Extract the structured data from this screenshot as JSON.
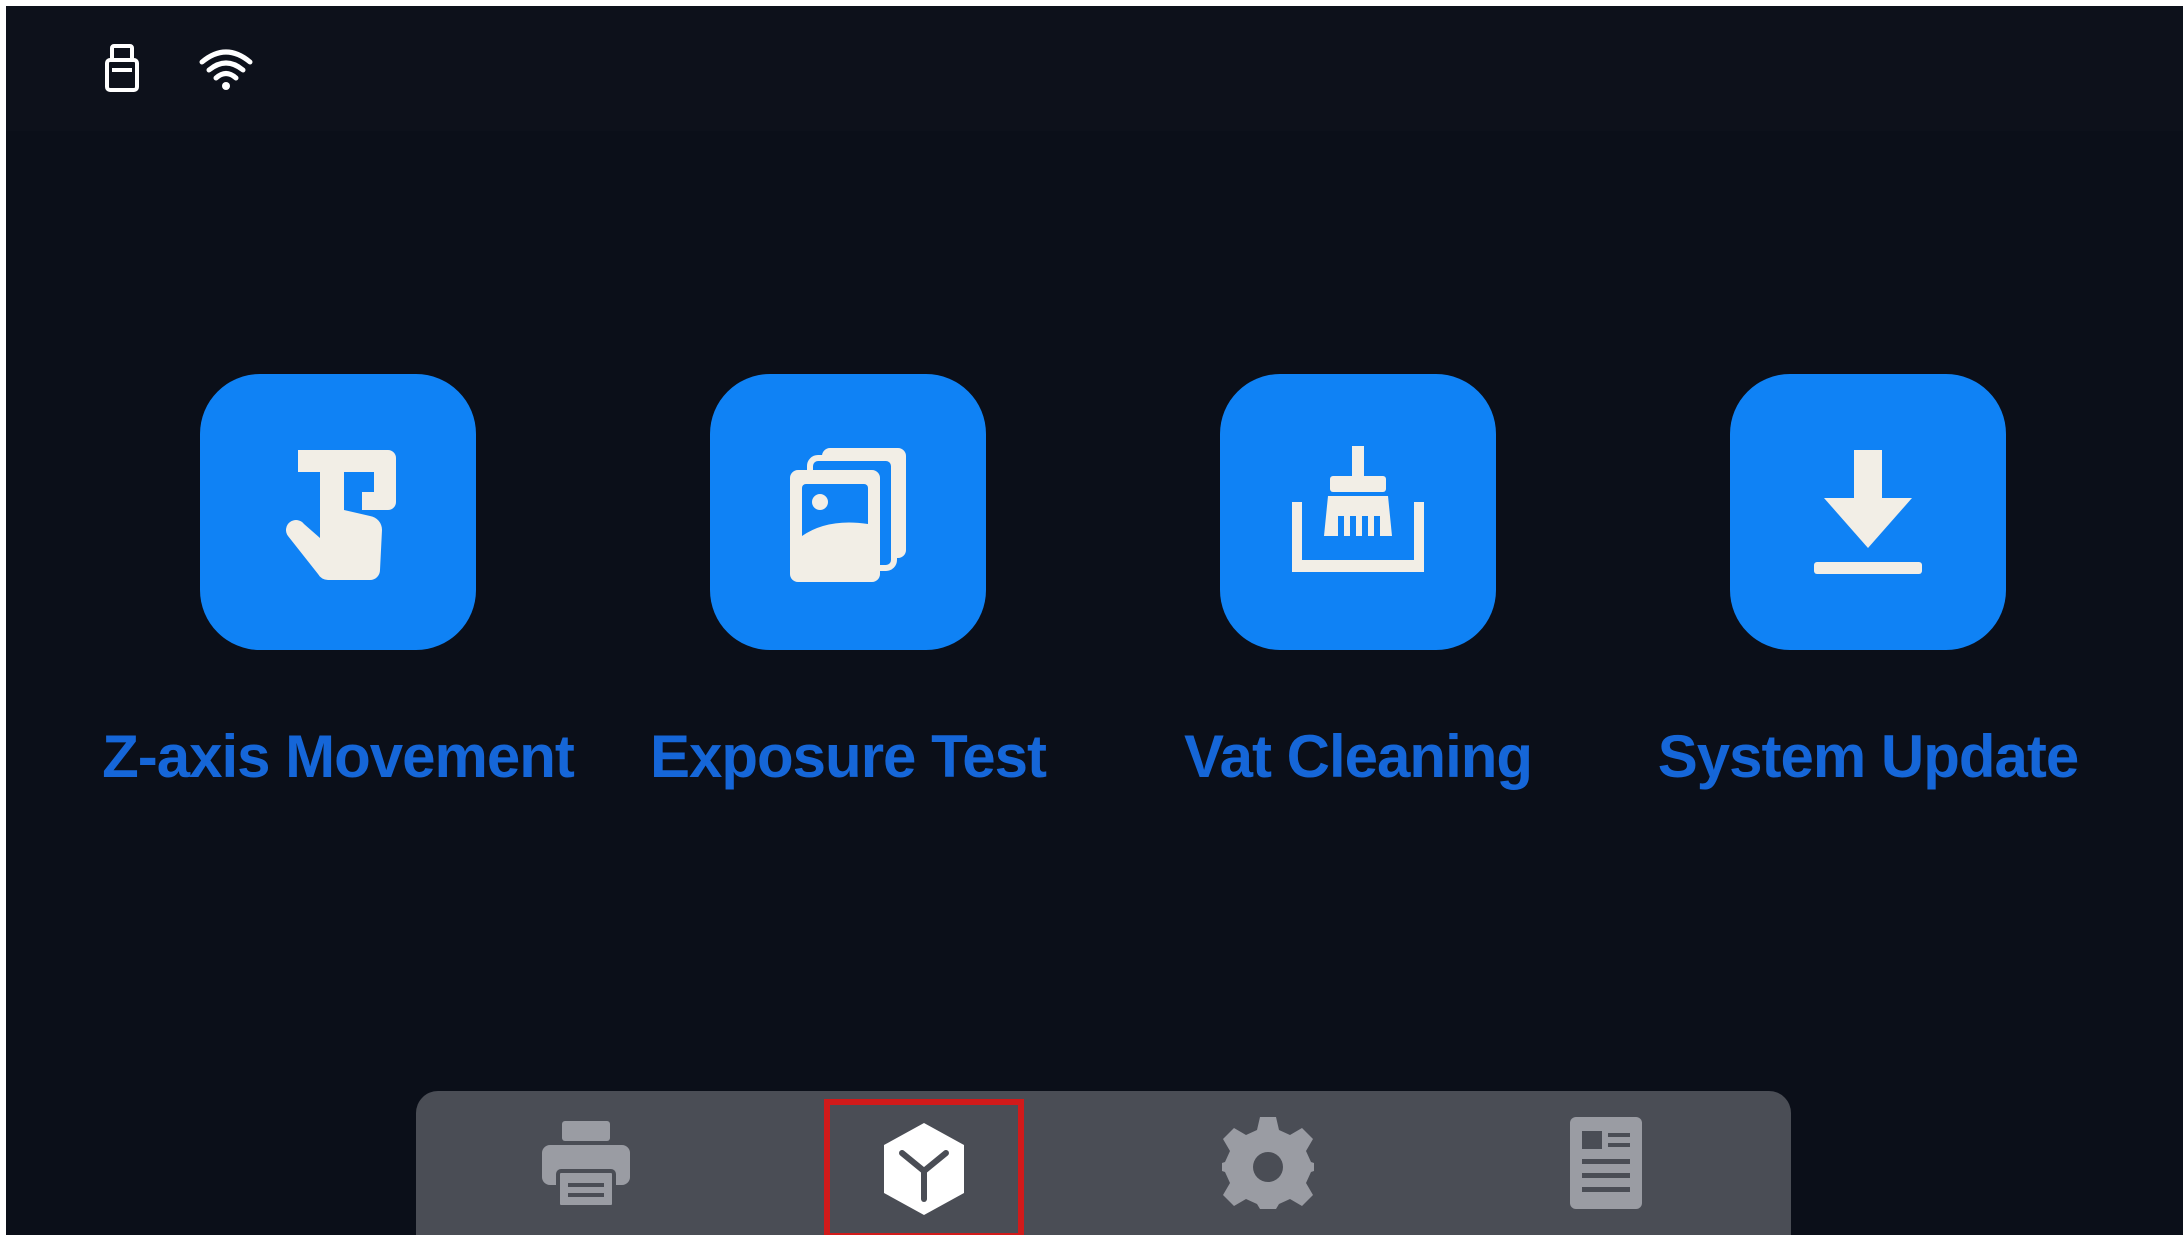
{
  "status_bar": {
    "icons": [
      "usb-drive-icon",
      "wifi-icon"
    ]
  },
  "tools": [
    {
      "label": "Z-axis Movement",
      "icon": "touch-hand-icon"
    },
    {
      "label": "Exposure Test",
      "icon": "image-stack-icon"
    },
    {
      "label": "Vat Cleaning",
      "icon": "brush-tray-icon"
    },
    {
      "label": "System Update",
      "icon": "download-icon"
    }
  ],
  "dock": {
    "items": [
      {
        "icon": "printer-icon",
        "selected": false
      },
      {
        "icon": "cube-tools-icon",
        "selected": true
      },
      {
        "icon": "gear-icon",
        "selected": false
      },
      {
        "icon": "document-info-icon",
        "selected": false
      }
    ],
    "colors": {
      "background": "#4a4d55",
      "icon": "#9a9ca3",
      "selected_icon": "#ffffff",
      "selection_outline": "#d11a1a"
    }
  },
  "colors": {
    "screen_background": "#0b0f19",
    "tile_background": "#0f82f5",
    "label_text": "#1566d8"
  }
}
